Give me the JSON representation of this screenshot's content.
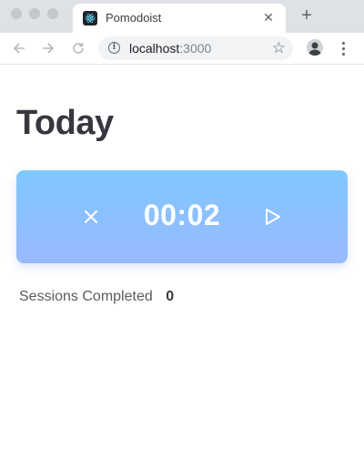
{
  "browser": {
    "tab": {
      "title": "Pomodoist",
      "close_icon": "close-icon",
      "favicon": "react-logo-icon"
    },
    "new_tab_icon": "plus-icon",
    "nav": {
      "back_icon": "arrow-left-icon",
      "forward_icon": "arrow-right-icon",
      "reload_icon": "reload-icon"
    },
    "address_bar": {
      "host": "localhost",
      "port": ":3000",
      "info_icon": "info-icon",
      "bookmark_icon": "star-icon"
    },
    "profile_icon": "avatar",
    "menu_icon": "kebab-menu-icon"
  },
  "page": {
    "title": "Today",
    "timer": {
      "time": "00:02",
      "reset_icon": "close-icon",
      "play_icon": "play-icon",
      "gradient_top": "#80c8ff",
      "gradient_bottom": "#99b9ff"
    },
    "sessions": {
      "label": "Sessions Completed",
      "count": "0"
    }
  }
}
